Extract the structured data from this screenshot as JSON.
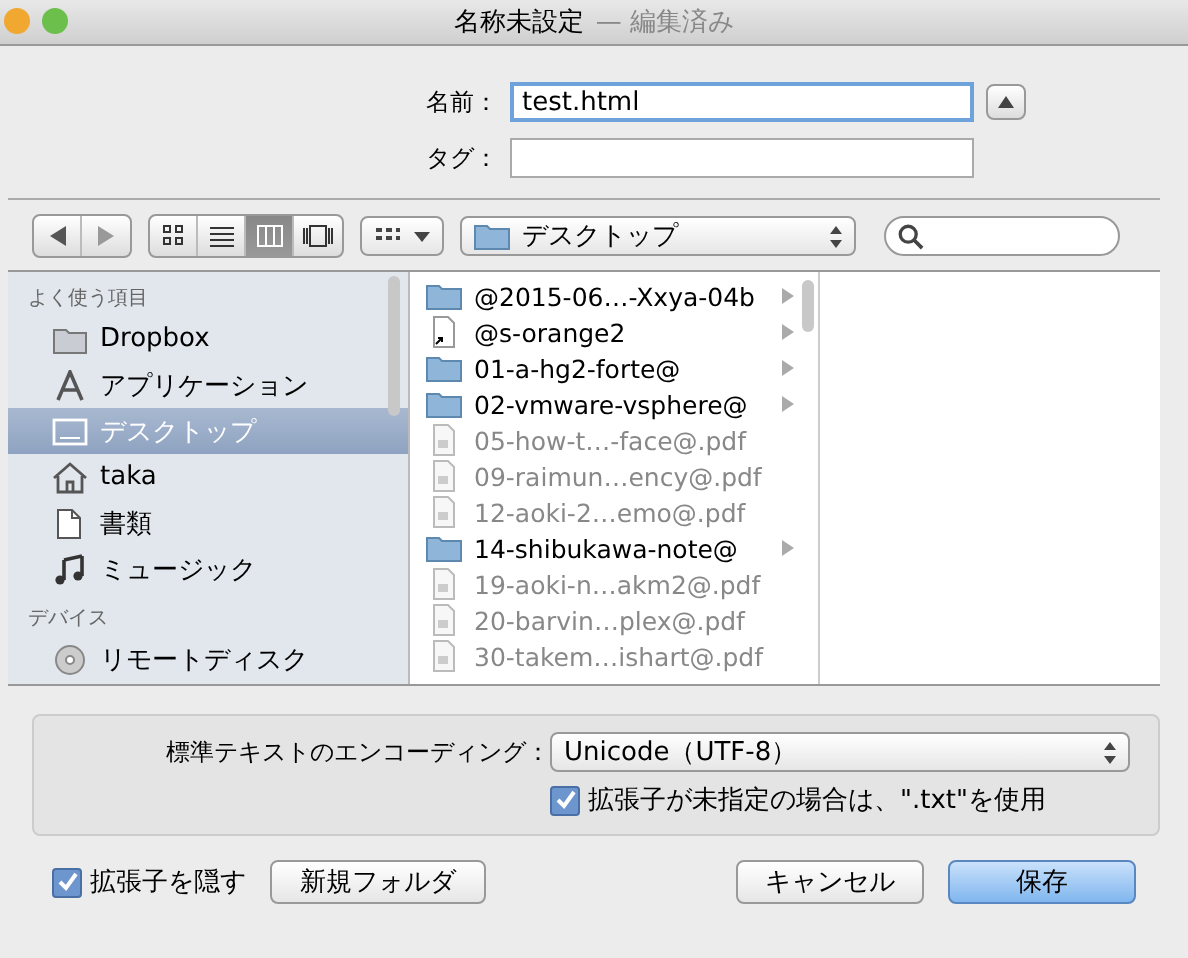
{
  "window": {
    "title": "名称未設定",
    "title_status": "— 編集済み"
  },
  "form": {
    "name_label": "名前：",
    "name_value": "test.html",
    "tag_label": "タグ："
  },
  "toolbar": {
    "view_buttons": [
      {
        "kind": "icons",
        "selected": false
      },
      {
        "kind": "list",
        "selected": false
      },
      {
        "kind": "columns",
        "selected": true
      },
      {
        "kind": "coverflow",
        "selected": false
      }
    ],
    "location": "デスクトップ"
  },
  "sidebar": {
    "sections": [
      {
        "title": "よく使う項目",
        "items": [
          {
            "label": "Dropbox",
            "kind": "folder",
            "selected": false
          },
          {
            "label": "アプリケーション",
            "kind": "apps",
            "selected": false
          },
          {
            "label": "デスクトップ",
            "kind": "desktop",
            "selected": true
          },
          {
            "label": "taka",
            "kind": "home",
            "selected": false
          },
          {
            "label": "書類",
            "kind": "documents",
            "selected": false
          },
          {
            "label": "ミュージック",
            "kind": "music",
            "selected": false
          }
        ]
      },
      {
        "title": "デバイス",
        "items": [
          {
            "label": "リモートディスク",
            "kind": "disc",
            "selected": false
          }
        ]
      }
    ]
  },
  "files": [
    {
      "name": "@2015-06…-Xxya-04b",
      "kind": "folder",
      "disabled": false
    },
    {
      "name": "@s-orange2",
      "kind": "alias",
      "disabled": false
    },
    {
      "name": "01-a-hg2-forte@",
      "kind": "folder",
      "disabled": false
    },
    {
      "name": "02-vmware-vsphere@",
      "kind": "folder",
      "disabled": false
    },
    {
      "name": "05-how-t…-face@.pdf",
      "kind": "document",
      "disabled": true
    },
    {
      "name": "09-raimun…ency@.pdf",
      "kind": "document",
      "disabled": true
    },
    {
      "name": "12-aoki-2…emo@.pdf",
      "kind": "document",
      "disabled": true
    },
    {
      "name": "14-shibukawa-note@",
      "kind": "folder",
      "disabled": false
    },
    {
      "name": "19-aoki-n…akm2@.pdf",
      "kind": "document",
      "disabled": true
    },
    {
      "name": "20-barvin…plex@.pdf",
      "kind": "document",
      "disabled": true
    },
    {
      "name": "30-takem…ishart@.pdf",
      "kind": "document",
      "disabled": true
    }
  ],
  "options": {
    "encoding_label": "標準テキストのエンコーディング：",
    "encoding_value": "Unicode（UTF-8）",
    "txt_checkbox": {
      "label": "拡張子が未指定の場合は、\".txt\"を使用",
      "checked": true
    }
  },
  "footer": {
    "hide_extension": {
      "label": "拡張子を隠す",
      "checked": true
    },
    "new_folder": "新規フォルダ",
    "cancel": "キャンセル",
    "save": "保存"
  }
}
